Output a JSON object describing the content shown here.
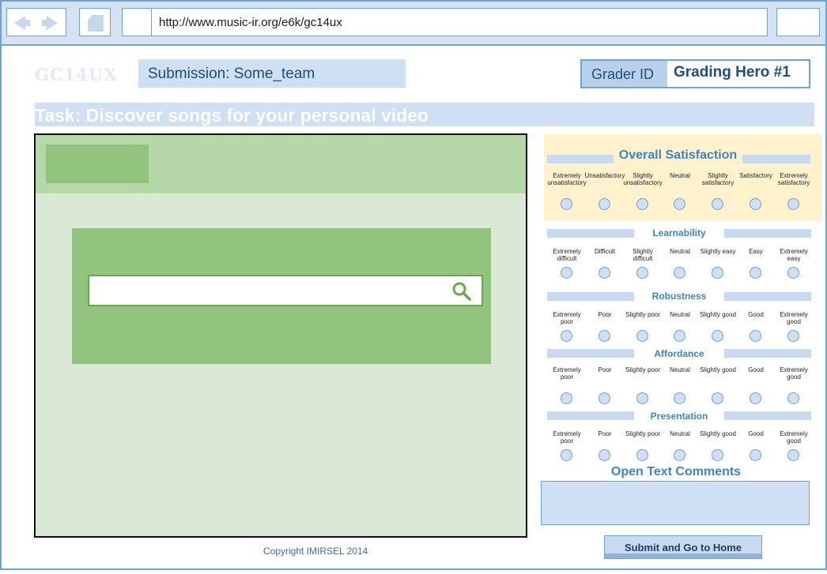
{
  "browser": {
    "url": "http://www.music-ir.org/e6k/gc14ux"
  },
  "header": {
    "logo": "GC14UX",
    "submission": "Submission: Some_team",
    "grader_label": "Grader ID",
    "grader_value": "Grading Hero #1",
    "task": "Task: Discover songs for your personal video"
  },
  "footer": {
    "copyright": "Copyright IMIRSEL 2014"
  },
  "grading": {
    "overall": {
      "title": "Overall Satisfaction",
      "labels": [
        "Extremely unsatisfactory",
        "Unsatisfactory",
        "Slightly unsatisfactory",
        "Neutral",
        "Slightly satisfactory",
        "Satisfactory",
        "Extremely satisfactory"
      ]
    },
    "learnability": {
      "title": "Learnability",
      "labels": [
        "Extremely difficult",
        "Difficult",
        "Slightly difficult",
        "Neutral",
        "Slightly easy",
        "Easy",
        "Extremely easy"
      ]
    },
    "robustness": {
      "title": "Robustness",
      "labels": [
        "Extremely poor",
        "Poor",
        "Slightly poor",
        "Neutral",
        "Slightly good",
        "Good",
        "Extremely good"
      ]
    },
    "affordance": {
      "title": "Affordance",
      "labels": [
        "Extremely poor",
        "Poor",
        "Slightly poor",
        "Neutral",
        "Slightly good",
        "Good",
        "Extremely good"
      ]
    },
    "presentation": {
      "title": "Presentation",
      "labels": [
        "Extremely poor",
        "Poor",
        "Slightly poor",
        "Neutral",
        "Slightly good",
        "Good",
        "Extremely good"
      ]
    },
    "comments_title": "Open Text Comments",
    "submit_label": "Submit and Go to Home"
  }
}
